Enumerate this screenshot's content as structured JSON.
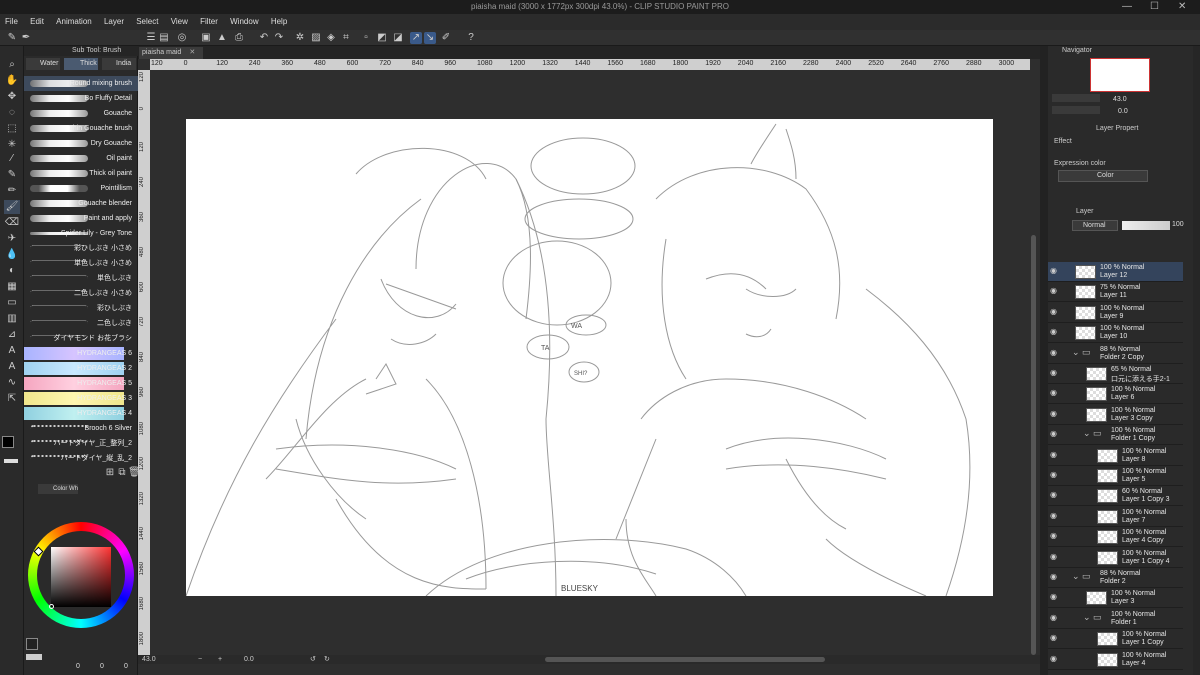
{
  "window": {
    "title": "piaisha maid (3000 x 1772px 300dpi 43.0%) - CLIP STUDIO PAINT PRO",
    "minimize": "—",
    "maximize": "☐",
    "close": "✕"
  },
  "menu": [
    "File",
    "Edit",
    "Animation",
    "Layer",
    "Select",
    "View",
    "Filter",
    "Window",
    "Help"
  ],
  "subtool": {
    "header": "Sub Tool: Brush",
    "tabs": [
      "Water",
      "Thick",
      "India"
    ],
    "brushes": [
      "Round mixing brush",
      "Bo Fluffy Detail",
      "Gouache",
      "Thin Gouache brush",
      "Dry Gouache",
      "Oil paint",
      "Thick oil paint",
      "Pointillism",
      "Gouache blender",
      "Paint and apply",
      "Spider Lily - Grey Tone",
      "彩ひしぶき 小さめ",
      "単色しぶき 小さめ",
      "単色しぶき",
      "二色しぶき 小さめ",
      "彩ひしぶき",
      "二色しぶき",
      "ダイヤモンド お花ブラシ",
      "HYDRANGEAS 6",
      "HYDRANGEAS 2",
      "HYDRANGEAS 5",
      "HYDRANGEAS 3",
      "HYDRANGEAS 4",
      "Brooch 6 Silver",
      "ハートダイヤ_正_整列_2",
      "ハートダイヤ_縦_乱_2"
    ]
  },
  "color_panel": {
    "tab": "Color Wh",
    "accent": "#ff3333",
    "footer_vals": [
      "0",
      "0",
      "0"
    ]
  },
  "document": {
    "tab": "piaisha maid"
  },
  "rulers": {
    "h": [
      "120",
      "0",
      "120",
      "240",
      "360",
      "480",
      "600",
      "720",
      "840",
      "960",
      "1080",
      "1200",
      "1320",
      "1440",
      "1560",
      "1680",
      "1800",
      "1920",
      "2040",
      "2160",
      "2280",
      "2400",
      "2520",
      "2640",
      "2760",
      "2880",
      "3000"
    ],
    "v": [
      "120",
      "0",
      "120",
      "240",
      "360",
      "480",
      "600",
      "720",
      "840",
      "960",
      "1080",
      "1200",
      "1320",
      "1440",
      "1560",
      "1680",
      "1800"
    ]
  },
  "canvas": {
    "speech": [
      "WA",
      "TA",
      "SHI?"
    ],
    "signature": "BLUESKY"
  },
  "status": {
    "zoom": "43.0",
    "angle": "0.0"
  },
  "navigator": {
    "tab": "Navigator",
    "zoom": "43.0",
    "angle": "0.0"
  },
  "layer_props": {
    "tab": "Layer Propert",
    "effect": "Effect",
    "expression_label": "Expression color",
    "expression_value": "Color"
  },
  "layer_panel": {
    "tab": "Layer",
    "blend": "Normal",
    "opacity": "100"
  },
  "layers": [
    {
      "type": "layer",
      "pct": "100 % Normal",
      "name": "Layer 12",
      "indent": 0,
      "selected": true
    },
    {
      "type": "layer",
      "pct": "75 % Normal",
      "name": "Layer 11",
      "indent": 0
    },
    {
      "type": "layer",
      "pct": "100 % Normal",
      "name": "Layer 9",
      "indent": 0
    },
    {
      "type": "layer",
      "pct": "100 % Normal",
      "name": "Layer 10",
      "indent": 0
    },
    {
      "type": "folder",
      "pct": "88 % Normal",
      "name": "Folder 2 Copy",
      "indent": 0
    },
    {
      "type": "layer",
      "pct": "65 % Normal",
      "name": "口元に添える手2-1",
      "indent": 1
    },
    {
      "type": "layer",
      "pct": "100 % Normal",
      "name": "Layer 6",
      "indent": 1
    },
    {
      "type": "layer",
      "pct": "100 % Normal",
      "name": "Layer 3 Copy",
      "indent": 1
    },
    {
      "type": "folder",
      "pct": "100 % Normal",
      "name": "Folder 1 Copy",
      "indent": 1
    },
    {
      "type": "layer",
      "pct": "100 % Normal",
      "name": "Layer 8",
      "indent": 2
    },
    {
      "type": "layer",
      "pct": "100 % Normal",
      "name": "Layer 5",
      "indent": 2
    },
    {
      "type": "layer",
      "pct": "60 % Normal",
      "name": "Layer 1 Copy 3",
      "indent": 2
    },
    {
      "type": "layer",
      "pct": "100 % Normal",
      "name": "Layer 7",
      "indent": 2
    },
    {
      "type": "layer",
      "pct": "100 % Normal",
      "name": "Layer 4 Copy",
      "indent": 2
    },
    {
      "type": "layer",
      "pct": "100 % Normal",
      "name": "Layer 1 Copy 4",
      "indent": 2
    },
    {
      "type": "folder",
      "pct": "88 % Normal",
      "name": "Folder 2",
      "indent": 0
    },
    {
      "type": "layer",
      "pct": "100 % Normal",
      "name": "Layer 3",
      "indent": 1
    },
    {
      "type": "folder",
      "pct": "100 % Normal",
      "name": "Folder 1",
      "indent": 1
    },
    {
      "type": "layer",
      "pct": "100 % Normal",
      "name": "Layer 1 Copy",
      "indent": 2
    },
    {
      "type": "layer",
      "pct": "100 % Normal",
      "name": "Layer 4",
      "indent": 2
    }
  ],
  "icons": {
    "tools": [
      "magnifier-icon",
      "hand-icon",
      "move-icon",
      "lasso-icon",
      "select-icon",
      "eyedropper-icon",
      "pen-icon",
      "pencil-icon",
      "brush-icon",
      "airbrush-icon",
      "eraser-icon",
      "blend-icon",
      "fill-icon",
      "gradient-icon",
      "figure-icon",
      "frame-icon",
      "ruler-icon",
      "text-icon",
      "balloon-icon",
      "line-icon",
      "correct-icon"
    ]
  }
}
